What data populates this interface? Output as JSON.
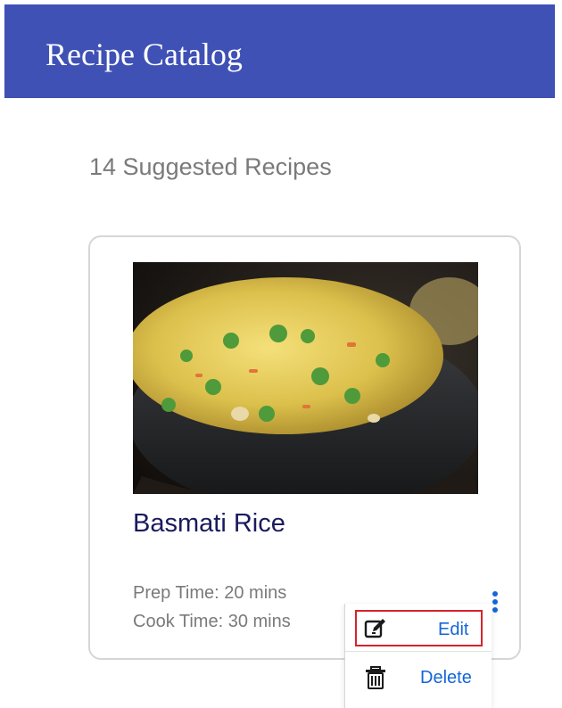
{
  "header": {
    "title": "Recipe Catalog"
  },
  "catalog": {
    "count_text": "14 Suggested Recipes"
  },
  "recipe": {
    "title": "Basmati Rice",
    "prep_time": "Prep Time: 20 mins",
    "cook_time": "Cook Time: 30 mins",
    "image_alt": "Bowl of basmati rice with peas"
  },
  "menu": {
    "items": [
      {
        "label": "Edit",
        "icon": "edit-icon"
      },
      {
        "label": "Delete",
        "icon": "trash-icon"
      }
    ]
  },
  "colors": {
    "header_bg": "#3f51b5",
    "title_text": "#1a1a5e",
    "link_blue": "#1565d8",
    "highlight_red": "#d6232b"
  }
}
